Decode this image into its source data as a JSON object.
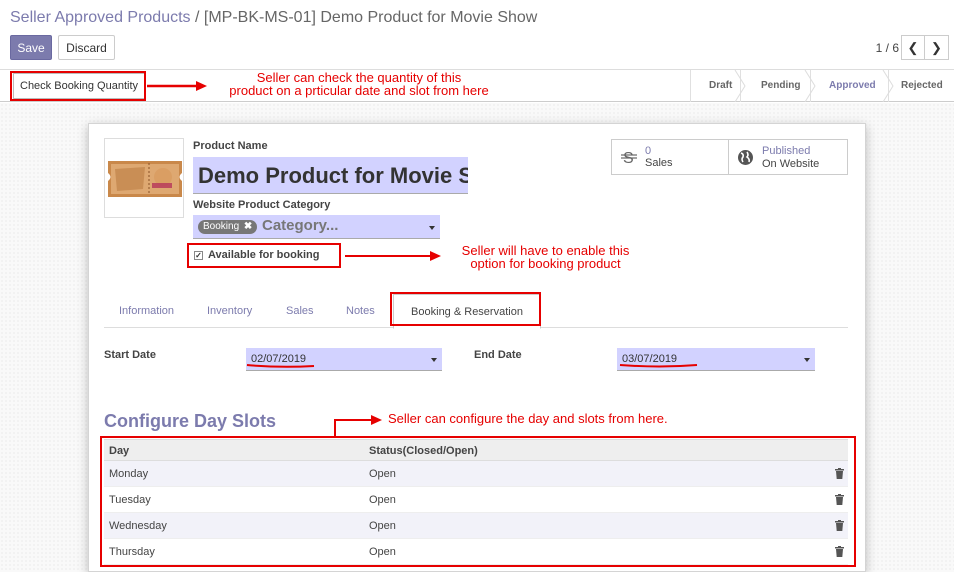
{
  "header": {
    "breadcrumb_parent": "Seller Approved Products",
    "breadcrumb_sep": "/",
    "breadcrumb_current": "[MP-BK-MS-01] Demo Product for Movie Show",
    "save_label": "Save",
    "discard_label": "Discard",
    "pager": "1 / 6"
  },
  "statusbar": {
    "check_button": "Check Booking Quantity",
    "stages": [
      "Draft",
      "Pending",
      "Approved",
      "Rejected"
    ],
    "active_stage": "Approved"
  },
  "form": {
    "product_name_label": "Product Name",
    "product_name": "Demo Product for Movie Show",
    "category_label": "Website Product Category",
    "category_tag": "Booking",
    "category_placeholder": "Category...",
    "available_label": "Available for booking",
    "available_checked": true,
    "stat_sales_value": "0",
    "stat_sales_label": "Sales",
    "stat_published_value": "Published",
    "stat_published_label": "On Website",
    "tabs": [
      "Information",
      "Inventory",
      "Sales",
      "Notes",
      "Booking & Reservation"
    ],
    "active_tab": "Booking & Reservation",
    "start_date_label": "Start Date",
    "start_date": "02/07/2019",
    "end_date_label": "End Date",
    "end_date": "03/07/2019",
    "slots_title": "Configure Day Slots",
    "table_headers": [
      "Day",
      "Status(Closed/Open)"
    ],
    "rows": [
      {
        "day": "Monday",
        "status": "Open"
      },
      {
        "day": "Tuesday",
        "status": "Open"
      },
      {
        "day": "Wednesday",
        "status": "Open"
      },
      {
        "day": "Thursday",
        "status": "Open"
      }
    ]
  },
  "annotations": {
    "a1_line1": "Seller can check the quantity of this",
    "a1_line2": "product on a prticular date and slot from here",
    "a2_line1": "Seller will have to enable this",
    "a2_line2": "option for booking product",
    "a3": "Seller can configure the day and slots from here."
  },
  "colors": {
    "primary": "#7c7bad",
    "input_bg": "#d2d2ff",
    "annotation": "#e60000"
  }
}
